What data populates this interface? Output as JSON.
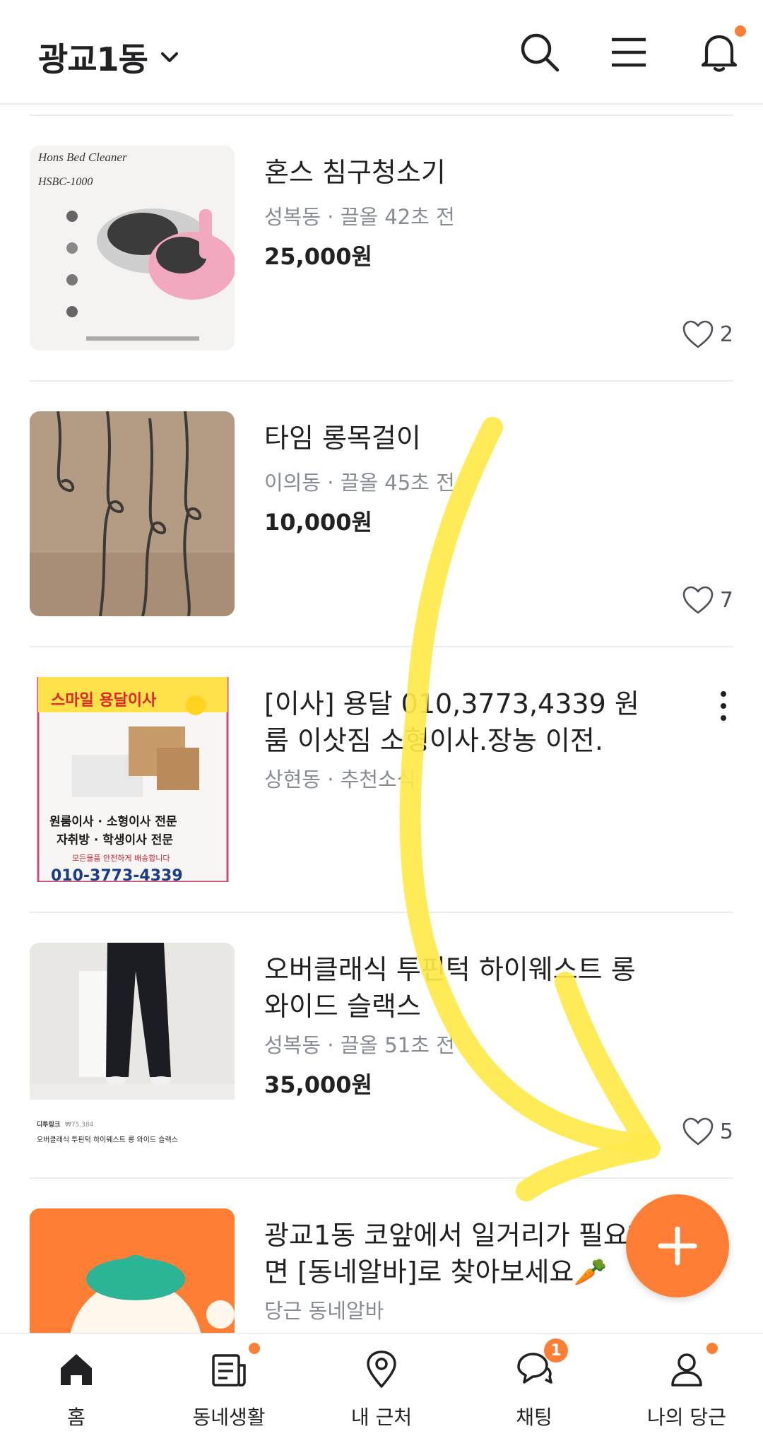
{
  "header": {
    "location": "광교1동"
  },
  "items": [
    {
      "title": "혼스 침구청소기",
      "meta": "성복동 · 끌올 42초 전",
      "price": "25,000원",
      "likes": "2",
      "thumb_text": [
        "Hons Bed Cleaner",
        "HSBC-1000"
      ]
    },
    {
      "title": "타임 롱목걸이",
      "meta": "이의동 · 끌올 45초 전",
      "price": "10,000원",
      "likes": "7"
    },
    {
      "title": "[이사] 용달 010,3773,4339 원룸 이삿짐 소형이사.장농 이전.",
      "meta": "상현동 · 추천소식",
      "thumb_text": [
        "스마일 용달이사",
        "원룸이사 · 소형이사 전문",
        "자취방 · 학생이사 전문",
        "모든물품 안전하게 배송합니다",
        "010-3773-4339"
      ]
    },
    {
      "title": "오버클래식 투핀턱 하이웨스트 롱 와이드 슬랙스",
      "meta": "성복동 · 끌올 51초 전",
      "price": "35,000원",
      "likes": "5",
      "thumb_text": [
        "디투링크",
        "₩75,384",
        "오버클래식 투핀턱 하이웨스트 롱 와이드 슬랙스"
      ]
    },
    {
      "title": "광교1동 코앞에서 일거리가 필요하면 [동네알바]로 찾아보세요🥕",
      "meta": "당근 동네알바"
    }
  ],
  "nav": [
    {
      "label": "홈",
      "icon": "home-icon"
    },
    {
      "label": "동네생활",
      "icon": "news-icon"
    },
    {
      "label": "내 근처",
      "icon": "location-pin-icon"
    },
    {
      "label": "채팅",
      "icon": "chat-icon",
      "badge": "1"
    },
    {
      "label": "나의 당근",
      "icon": "profile-icon"
    }
  ],
  "colors": {
    "accent": "#ff7e36",
    "annotation": "#ffe84a"
  }
}
